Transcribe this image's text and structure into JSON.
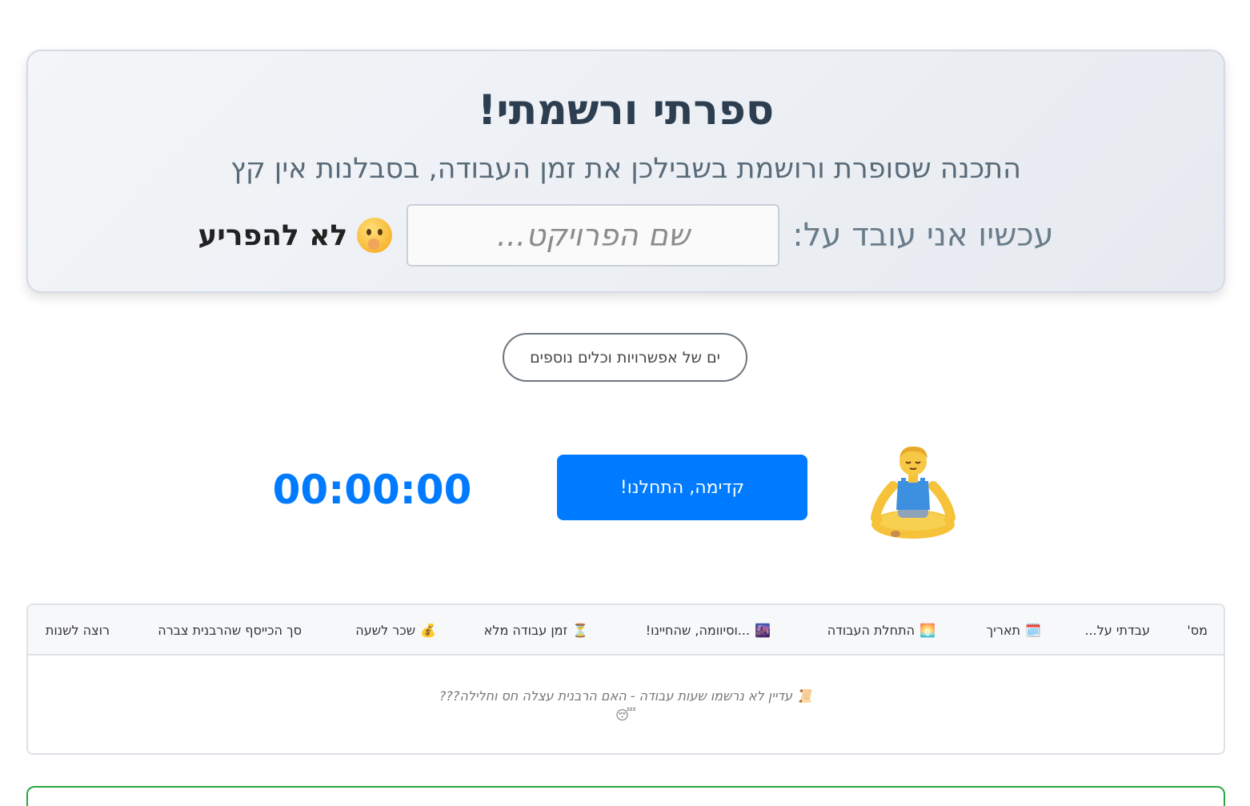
{
  "hero": {
    "title": "ספרתי ורשמתי!",
    "subtitle": "התכנה שסופרת ורושמת בשבילכן את זמן העבודה, בסבלנות אין קץ",
    "project_label": "עכשיו אני עובד על:",
    "project_placeholder": "שם הפרויקט...",
    "project_value": "",
    "dnd_label": "לא להפריע",
    "dnd_icon": "shushing-face-icon"
  },
  "options_button": "ים של אפשרויות וכלים נוספים",
  "timer": {
    "start_label": "קדימה, התחלנו!",
    "display": "00:00:00",
    "idle_icon": "person-meditating-icon"
  },
  "table": {
    "columns": [
      {
        "icon": "",
        "label": "מס'"
      },
      {
        "icon": "",
        "label": "עבדתי על..."
      },
      {
        "icon": "🗓️",
        "label": "תאריך"
      },
      {
        "icon": "🌅",
        "label": "התחלת העבודה"
      },
      {
        "icon": "🌆",
        "label": "...וסיוומה, שהחיינו!"
      },
      {
        "icon": "⏳",
        "label": "זמן עבודה מלא"
      },
      {
        "icon": "💰",
        "label": "שכר לשעה"
      },
      {
        "icon": "",
        "label": "סך הכייסף שהרבנית צברה"
      },
      {
        "icon": "",
        "label": "רוצה לשנות"
      }
    ],
    "empty_icon": "📜",
    "empty_message": "עדיין לא נרשמו שעות עבודה - האם הרבנית עצלה חס וחלילה???",
    "empty_emoji": "😴"
  },
  "colors": {
    "primary": "#007bff",
    "title": "#2c3e50",
    "success_border": "#28a745"
  }
}
